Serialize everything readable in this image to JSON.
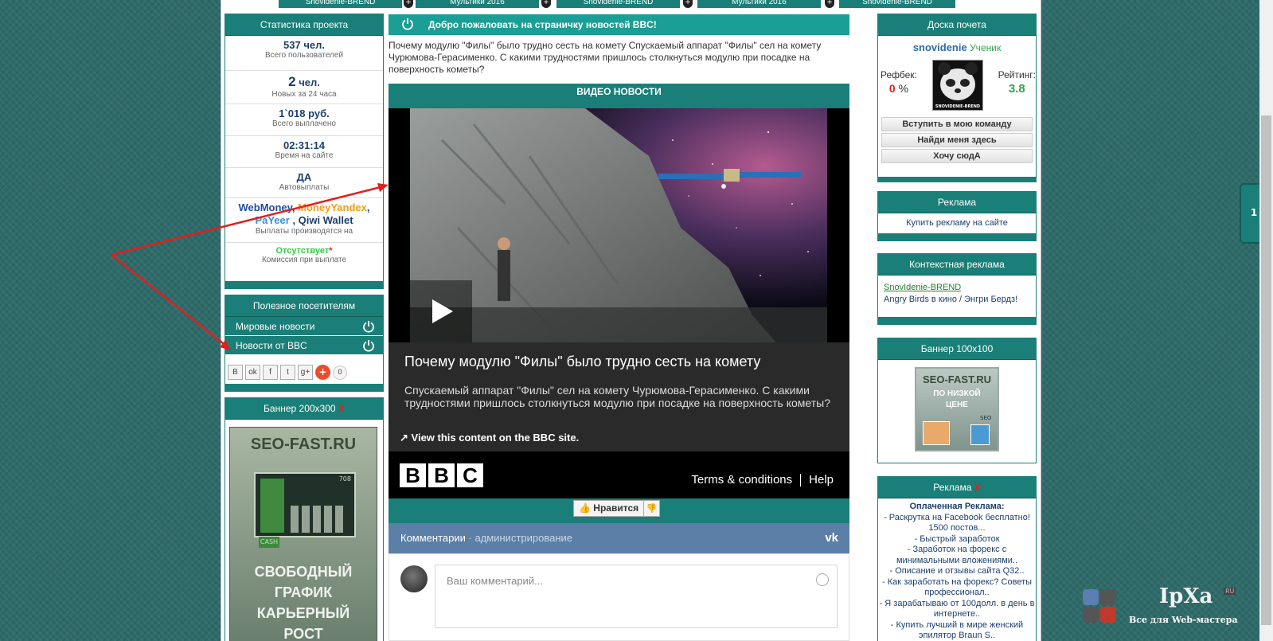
{
  "top_tabs": [
    "Snovidenie-BREND",
    "Мультики 2016",
    "Snovidenie-BREND",
    "Мультики 2016",
    "Snovidenie-BREND"
  ],
  "stats": {
    "title": "Статистика проекта",
    "items": [
      {
        "value": "537 чел.",
        "label": "Всего пользователей"
      },
      {
        "value_big": "2",
        "value_rest": " чел.",
        "label": "Новых за 24 часа"
      },
      {
        "value": "1`018 руб.",
        "label": "Всего выплачено"
      },
      {
        "value": "02:31:14",
        "label": "Время на сайте"
      },
      {
        "value": "ДА",
        "label": "Автовыплаты"
      }
    ],
    "payments": {
      "webmoney": "WebMoney",
      "moneyyandex": "MoneyYandex",
      "payeer": "PaYeer",
      "qiwi": "Qiwi Wallet",
      "label": "Выплаты производятся на"
    },
    "commission": {
      "value": "Отсутствует",
      "star": "*",
      "label": "Комиссия при выплате"
    }
  },
  "useful": {
    "title": "Полезное посетителям",
    "items": [
      "Мировые новости",
      "Новости от BBC"
    ],
    "share_count": "0"
  },
  "banner200": {
    "title": "Баннер 200x300",
    "x": "X",
    "brand": "SEO-FAST.RU",
    "cash": "CASH",
    "num": "708",
    "slogan": [
      "СВОБОДНЫЙ",
      "ГРАФИК",
      "КАРЬЕРНЫЙ",
      "РОСТ"
    ]
  },
  "center": {
    "title": "Добро пожаловать на страничку новостей BBC!",
    "intro": "Почему модулю \"Филы\" было трудно сесть на комету Спускаемый аппарат \"Филы\" сел на комету Чурюмова-Герасименко. С какими трудностями пришлось столкнуться модулю при посадке на поверхность кометы?",
    "video_head": "ВИДЕО НОВОСТИ",
    "video_title": "Почему модулю \"Филы\" было трудно сесть на комету",
    "video_desc": "Спускаемый аппарат \"Филы\" сел на комету Чурюмова-Герасименко. С какими трудностями пришлось столкнуться модулю при посадке на поверхность кометы?",
    "view_link": "View this content on the BBC site.",
    "bbc_letters": [
      "B",
      "B",
      "C"
    ],
    "terms": "Terms & conditions",
    "help": "Help",
    "like": "Нравится"
  },
  "vk": {
    "comments": "Комментарии",
    "dot": "·",
    "admin": "администрирование",
    "logo": "vk",
    "placeholder": "Ваш комментарий..."
  },
  "honor": {
    "title": "Доска почета",
    "user": "snovidenie",
    "rank": "Ученик",
    "refback_label": "Рефбек:",
    "refback_value": "0",
    "refback_unit": "%",
    "rating_label": "Рейтинг:",
    "rating_value": "3.8",
    "avatar_caption": "SNOVIDENIE-BREND",
    "buttons": [
      "Вступить в мою команду",
      "Найди меня здесь",
      "Хочу сюдА"
    ]
  },
  "ads": {
    "title": "Реклама",
    "link": "Купить рекламу на сайте"
  },
  "context": {
    "title": "Контекстная реклама",
    "link": "SnovIdenie-BREND",
    "text": "Angry Birds в кино / Энгри Бердз!"
  },
  "banner100": {
    "title": "Баннер 100x100",
    "brand": "SEO-FAST.RU",
    "line1": "ПО НИЗКОЙ",
    "line2": "ЦЕНЕ",
    "seo": "SEO"
  },
  "paid_ads": {
    "title": "Реклама",
    "x": "X",
    "heading": "Оплаченная Реклама:",
    "items": [
      "- Раскрутка на Facebook бесплатно! 1500 постов...",
      "- Быстрый заработок",
      "- Заработок на форекс с минимальными вложениями..",
      "- Описание и отзывы сайта Q32..",
      "- Как заработать на форекс? Советы профессионал..",
      "- Я зарабатываю от 100долл. в день в интернете..",
      "- Купить лучший в мире женский эпилятор Braun S.."
    ]
  },
  "side_tab": "1",
  "ipxa": {
    "title": "IpXa",
    "ru": "RU",
    "sub": "Все для Web-мастера"
  },
  "colors": {
    "teal": "#1a7f78",
    "teal_light": "#1a9e95",
    "vk_blue": "#5b7fa6",
    "red": "#e02020"
  }
}
